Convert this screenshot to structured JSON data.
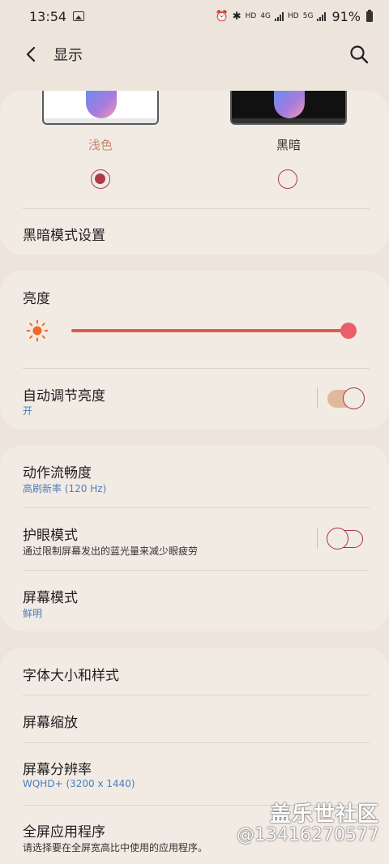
{
  "status": {
    "time": "13:54",
    "network_labels": [
      "HD",
      "4G",
      "HD",
      "5G"
    ],
    "battery": "91%"
  },
  "header": {
    "title": "显示"
  },
  "theme": {
    "light_label": "浅色",
    "dark_label": "黑暗",
    "selected": "light",
    "dark_settings": "黑暗模式设置"
  },
  "brightness": {
    "title": "亮度",
    "level_percent": 100,
    "auto_title": "自动调节亮度",
    "auto_value": "开",
    "auto_enabled": true
  },
  "motion": {
    "smoothness_title": "动作流畅度",
    "smoothness_value": "高刷新率 (120 Hz)",
    "eye_title": "护眼模式",
    "eye_desc": "通过限制屏幕发出的蓝光量来减少眼疲劳",
    "eye_enabled": false,
    "screen_mode_title": "屏幕模式",
    "screen_mode_value": "鲜明"
  },
  "display": {
    "font_title": "字体大小和样式",
    "zoom_title": "屏幕缩放",
    "resolution_title": "屏幕分辨率",
    "resolution_value": "WQHD+ (3200 x 1440)",
    "fullscreen_title": "全屏应用程序",
    "fullscreen_desc": "请选择要在全屏宽高比中使用的应用程序。"
  },
  "watermark": {
    "line1": "盖乐世社区",
    "line2": "@13416270577"
  },
  "colors": {
    "accent_red": "#b03a48",
    "slider_fill": "#e05a4a",
    "sub_text_blue": "#4a7ec0",
    "background": "#ede4dc",
    "card": "#f2ebe4"
  }
}
